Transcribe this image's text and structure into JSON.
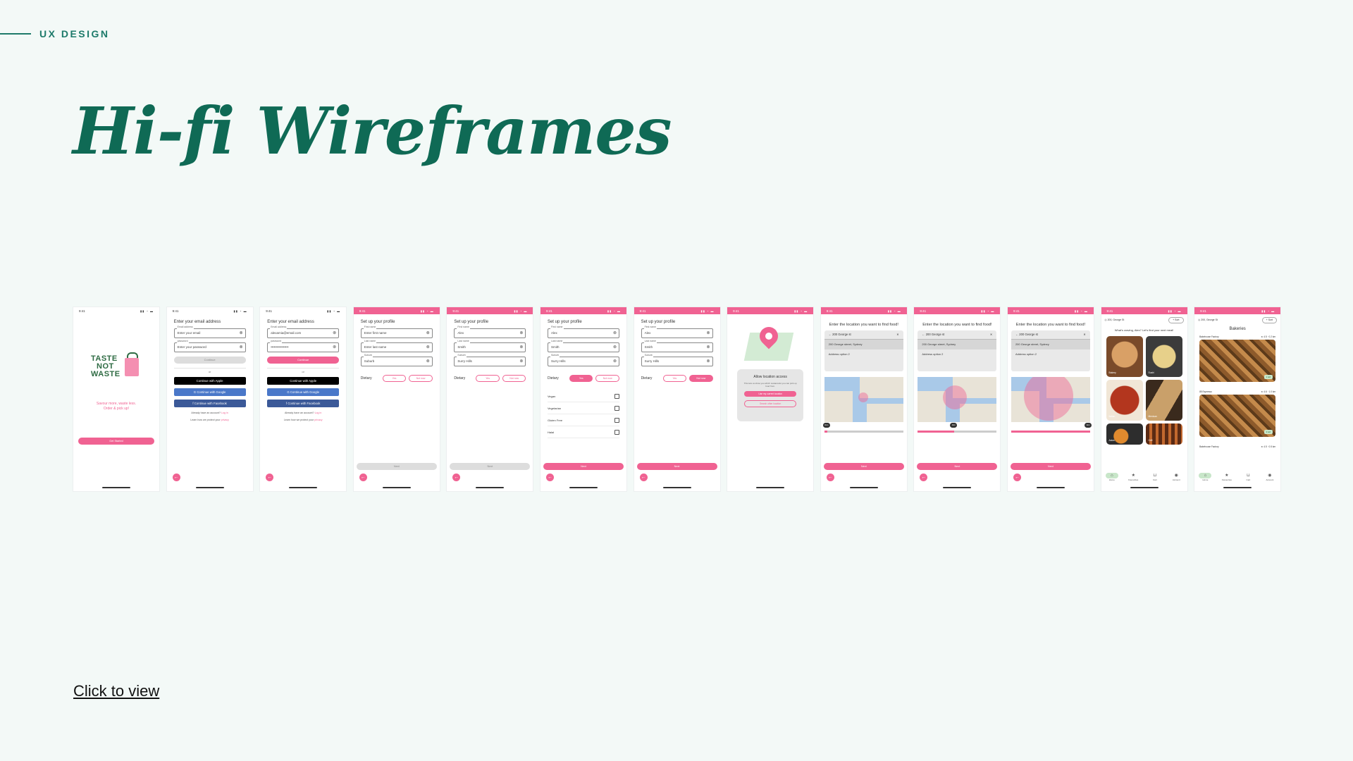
{
  "eyebrow": "UX DESIGN",
  "title": "Hi-fi Wireframes",
  "cta": "Click to view",
  "colors": {
    "accent": "#f06292",
    "brand": "#0f6a55",
    "background": "#f3f9f7"
  },
  "status_time": "9:41",
  "splash": {
    "logo_lines": [
      "TASTE",
      "NOT",
      "WASTE"
    ],
    "tagline": [
      "Savour more, waste less.",
      "Order & pick up!"
    ],
    "button": "Get Started"
  },
  "email1": {
    "title": "Enter your email address",
    "email_label": "Email address",
    "email_value": "Enter your email",
    "password_label": "password",
    "password_value": "Enter your password",
    "continue": "Continue",
    "or": "or",
    "apple": "Continue with Apple",
    "google": "Continue with Google",
    "facebook": "Continue with Facebook",
    "account_text": "Already have an account?",
    "login": "Log in",
    "privacy_text": "Learn how we protect your",
    "privacy": "privacy"
  },
  "email2": {
    "email_value": "alexamia@email.com",
    "password_value": "••••••••••••••••"
  },
  "profile": {
    "title": "Set up your profile",
    "first_label": "First name",
    "last_label": "Last name",
    "suburb_label": "Suburb",
    "dietary": "Dietary",
    "yes": "Yes",
    "not_now": "Not now",
    "next": "Next"
  },
  "profile1": {
    "first": "Enter first name",
    "last": "Enter last name",
    "suburb": "Suburb"
  },
  "profile2": {
    "first": "Alex",
    "last": "Smith",
    "suburb": "Surry Hills"
  },
  "diet_options": [
    "Vegan",
    "Vegetarian",
    "Gluten Free",
    "Halal"
  ],
  "location": {
    "title": "Allow location access",
    "subtitle": "This lets us show you which restaurants you can pick up food from.",
    "allow": "Use my current location",
    "other": "Search other location"
  },
  "find": {
    "heading": "Enter the location you want to find food!",
    "search": "200 George st",
    "option1": "200 George street, Sydney",
    "option2": "Address option 2",
    "next": "Next",
    "km": "1km"
  },
  "home": {
    "address": "200, George St",
    "chip": "+ Sort",
    "greeting": "What's craving, Alex? Let's find your next meal!",
    "categories": [
      "Bakery",
      "Sushi",
      "Italian",
      "Mexican",
      "Asian",
      "Grill"
    ],
    "nav": [
      "Home",
      "Favourites",
      "Cart",
      "Account"
    ]
  },
  "bakeries": {
    "section": "Bakeries",
    "store1": "Bakehouse Factory",
    "store1_meta": "★ 4.5  · 0.2 km",
    "store2": "85 Espresso",
    "store2_meta": "★ 4.6  · 1.0 km",
    "store3": "Bakehouse Factory",
    "store3_meta": "★ 4.5  · 0.5 km",
    "left1": "1 left",
    "left2": "3 left"
  }
}
